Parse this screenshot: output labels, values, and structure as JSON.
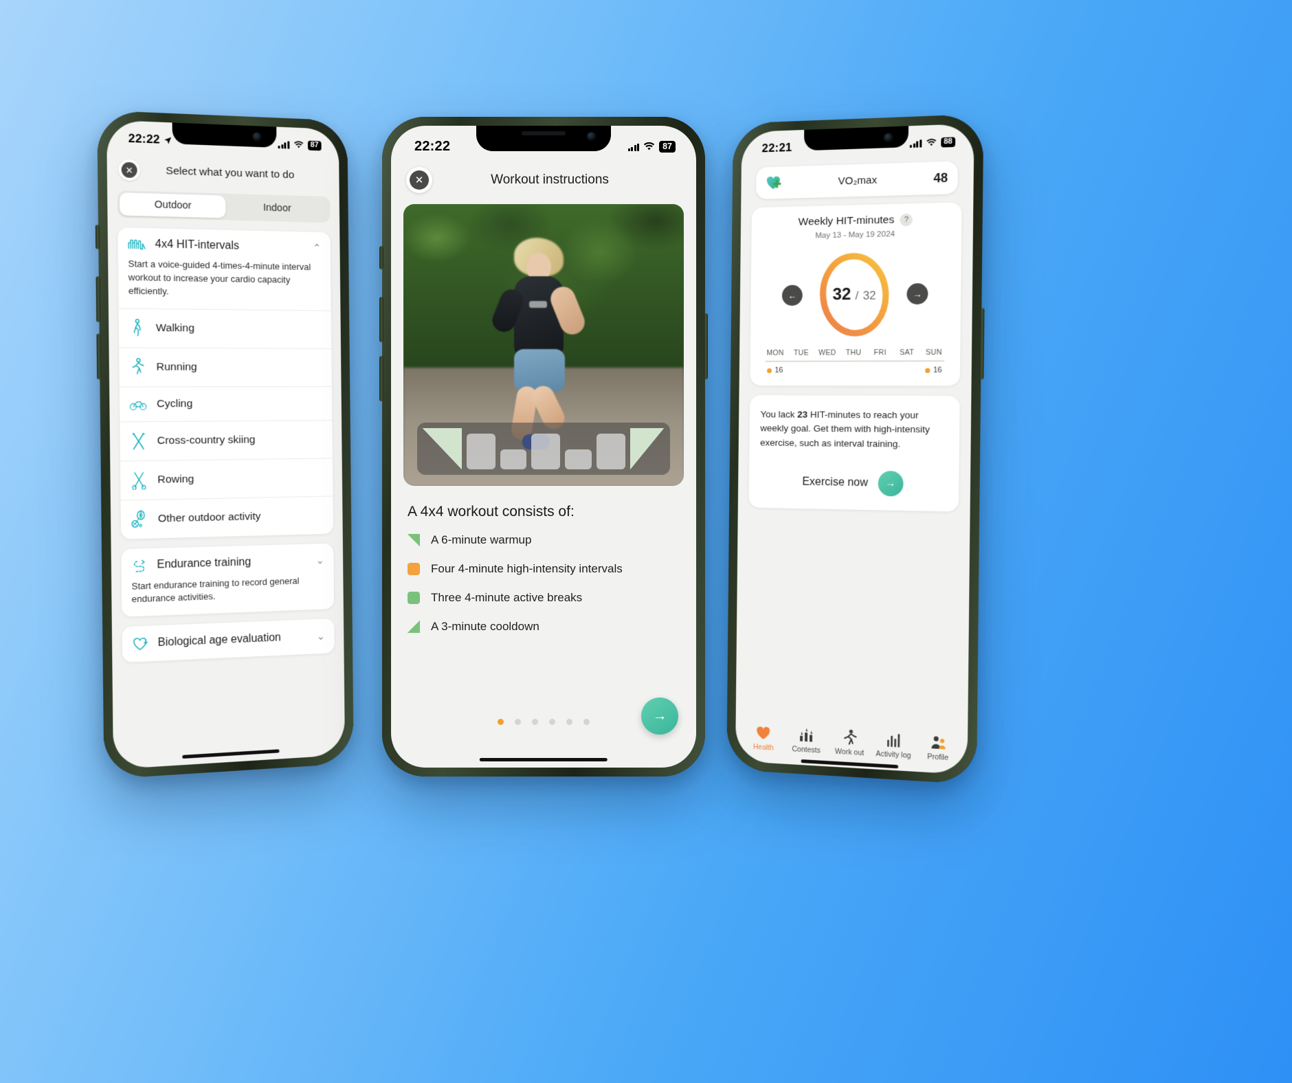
{
  "phone_left": {
    "status": {
      "time": "22:22",
      "location_icon": "location-arrow-icon",
      "battery": "87"
    },
    "header": {
      "title": "Select what you want to do",
      "close_icon": "close-icon"
    },
    "segments": [
      {
        "label": "Outdoor",
        "selected": true
      },
      {
        "label": "Indoor",
        "selected": false
      }
    ],
    "card_hit": {
      "icon": "interval-wave-icon",
      "title": "4x4 HIT-intervals",
      "chevron": "chevron-up-icon",
      "description": "Start a voice-guided 4-times-4-minute interval workout to increase your cardio capacity efficiently.",
      "activities": [
        {
          "icon": "walking-icon",
          "label": "Walking"
        },
        {
          "icon": "running-icon",
          "label": "Running"
        },
        {
          "icon": "cycling-icon",
          "label": "Cycling"
        },
        {
          "icon": "skiing-icon",
          "label": "Cross-country skiing"
        },
        {
          "icon": "rowing-icon",
          "label": "Rowing"
        },
        {
          "icon": "racket-icon",
          "label": "Other outdoor activity"
        }
      ]
    },
    "card_endurance": {
      "icon": "endurance-icon",
      "title": "Endurance training",
      "chevron": "chevron-down-icon",
      "description": "Start endurance training to record general endurance activities."
    },
    "card_bioage": {
      "icon": "heart-plus-icon",
      "title": "Biological age evaluation",
      "chevron": "chevron-down-icon"
    }
  },
  "phone_mid": {
    "status": {
      "time": "22:22",
      "battery": "87"
    },
    "header": {
      "title": "Workout instructions",
      "close_icon": "close-icon"
    },
    "media": {
      "alt": "runner-video-thumbnail",
      "overlay": "interval-profile-chart"
    },
    "section_title": "A 4x4 workout consists of:",
    "bullets": [
      {
        "marker": "ramp-up-triangle",
        "color": "#7ac27c",
        "text": "A 6-minute warmup"
      },
      {
        "marker": "square",
        "color": "#f3a23e",
        "text": "Four 4-minute high-intensity intervals"
      },
      {
        "marker": "square",
        "color": "#7ac27c",
        "text": "Three 4-minute active breaks"
      },
      {
        "marker": "ramp-down-triangle",
        "color": "#7ac27c",
        "text": "A 3-minute cooldown"
      }
    ],
    "pagination": {
      "total": 6,
      "active_index": 0
    },
    "next_button": {
      "icon": "arrow-right-icon",
      "label": ""
    }
  },
  "phone_right": {
    "status": {
      "time": "22:21",
      "battery": "88"
    },
    "vo2": {
      "icon": "heart-plus-icon",
      "label": "VO₂max",
      "value": "48"
    },
    "weekly": {
      "title": "Weekly HIT-minutes",
      "help_icon": "question-mark-icon",
      "date_range": "May 13 - May 19 2024",
      "prev_icon": "arrow-left-icon",
      "next_icon": "arrow-right-icon",
      "value": "32",
      "separator": "/",
      "goal": "32"
    },
    "advice": {
      "text_before": "You lack ",
      "amount": "23",
      "text_after": " HIT-minutes to reach your weekly goal. Get them with high-intensity exercise, such as interval training.",
      "cta_label": "Exercise now",
      "cta_icon": "arrow-right-icon"
    },
    "tabs": [
      {
        "icon": "heart-icon",
        "label": "Health",
        "active": true
      },
      {
        "icon": "trophy-icon",
        "label": "Contests",
        "active": false
      },
      {
        "icon": "runner-icon",
        "label": "Work out",
        "active": false
      },
      {
        "icon": "bar-chart-icon",
        "label": "Activity log",
        "active": false
      },
      {
        "icon": "person-icon",
        "label": "Profile",
        "active": false
      }
    ]
  },
  "chart_data": {
    "type": "bar",
    "title": "Weekly HIT-minutes",
    "subtitle": "May 13 - May 19 2024",
    "categories": [
      "MON",
      "TUE",
      "WED",
      "THU",
      "FRI",
      "SAT",
      "SUN"
    ],
    "values": [
      16,
      0,
      0,
      0,
      0,
      0,
      16
    ],
    "labels": [
      "16",
      "",
      "",
      "",
      "",
      "",
      "16"
    ],
    "total": 32,
    "goal": 32,
    "ylabel": "HIT-minutes",
    "xlabel": "",
    "grid": false,
    "legend": "none",
    "colors": {
      "accent": "#f0a02e",
      "ring_gradient_from": "#f3b63f",
      "ring_gradient_to": "#ef7f4a"
    }
  },
  "colors": {
    "teal": "#10b0bd",
    "orange": "#f0a02e",
    "green": "#7ac27c",
    "mint": "#3bb59c",
    "dark": "#4a4a48",
    "background_from": "#a8d5fb",
    "background_to": "#2e90f5"
  }
}
